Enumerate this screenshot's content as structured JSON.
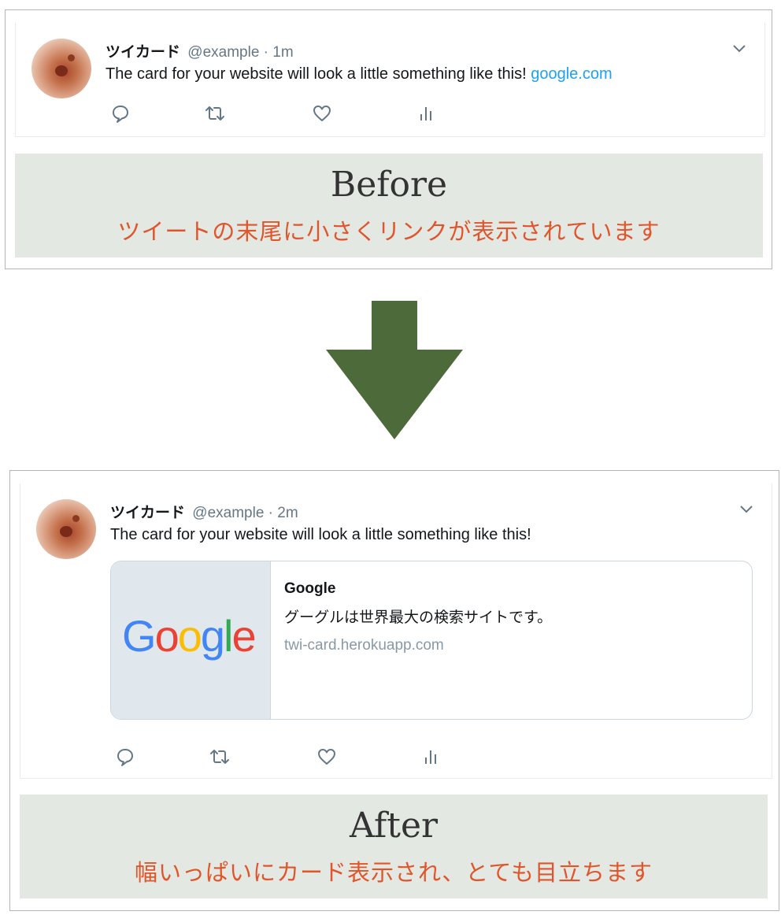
{
  "before": {
    "tweet": {
      "name": "ツイカード",
      "handle": "@example · 1m",
      "text": "The card for your website will look a little something like this! ",
      "link": "google.com"
    },
    "caption": {
      "title": "Before",
      "subtitle": "ツイートの末尾に小さくリンクが表示されています"
    }
  },
  "after": {
    "tweet": {
      "name": "ツイカード",
      "handle": "@example · 2m",
      "text": "The card for your website will look a little something like this!"
    },
    "card": {
      "logo_letters": [
        "G",
        "o",
        "o",
        "g",
        "l",
        "e"
      ],
      "title": "Google",
      "description": "グーグルは世界最大の検索サイトです。",
      "url": "twi-card.herokuapp.com"
    },
    "caption": {
      "title": "After",
      "subtitle": "幅いっぱいにカード表示され、とても目立ちます"
    }
  },
  "icons": [
    "reply-icon",
    "retweet-icon",
    "like-icon",
    "analytics-icon",
    "chevron-down-icon",
    "down-arrow-icon"
  ],
  "colors": {
    "accent_link": "#1da1f2",
    "caption_bg": "#e3e8e2",
    "caption_text": "#e0552b",
    "arrow": "#4d6b3a",
    "google_blue": "#4285f4",
    "google_red": "#ea4335",
    "google_yellow": "#fbbc05",
    "google_green": "#34a853"
  }
}
